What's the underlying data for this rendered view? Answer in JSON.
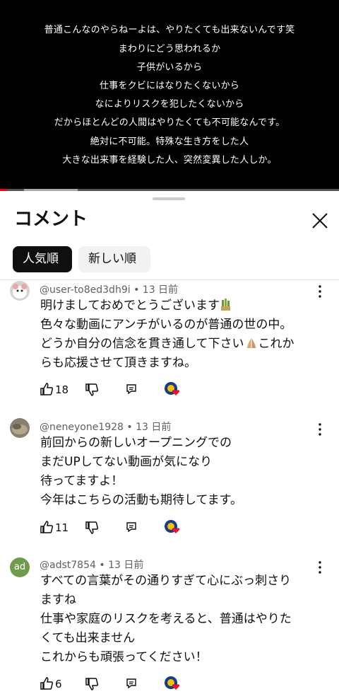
{
  "video": {
    "subtitles": [
      "普通こんなのやらねーよは、やりたくても出来ないんです笑",
      "まわりにどう思われるか",
      "子供がいるから",
      "仕事をクビにはなりたくないから",
      "なによりリスクを犯したくないから",
      "だからほとんどの人間はやりたくても不可能なんです。",
      "絶対に不可能。特殊な生き方をした人",
      "大きな出来事を経験した人、突然変異した人しか。"
    ],
    "progress_fraction": 0.02,
    "buffer_fraction": 0.23,
    "colors": {
      "progress": "#ff0000",
      "buffer": "#aaaaaa"
    }
  },
  "panel": {
    "title": "コメント",
    "close_icon": "close-icon",
    "chips": {
      "popular": "人気順",
      "newest": "新しい順"
    }
  },
  "comments": [
    {
      "author": "@user-to8ed3dh9i",
      "age": "13 日前",
      "lines": [
        "明けましておめでとうございます",
        "色々な動画にアンチがいるのが普通の世の中。",
        "どうか自分の信念を貫き通して下さい",
        "らも応援させて頂きますね。"
      ],
      "line3_tail": "これか",
      "emojis": [
        "kadomatsu-emoji",
        "praying-hands-emoji"
      ],
      "likes": "18"
    },
    {
      "author": "@neneyone1928",
      "age": "13 日前",
      "lines": [
        "前回からの新しいオープニングでの",
        "まだUPしてない動画が気になり",
        "待ってますよ！",
        "今年はこちらの活動も期待してます。"
      ],
      "likes": "11"
    },
    {
      "author": "@adst7854",
      "age": "13 日前",
      "avatar_text": "ad",
      "lines": [
        "すべての言葉がその通りすぎて心にぶっ刺さり",
        "ますね",
        "仕事や家庭のリスクを考えると、普通はやりた",
        "くても出来ません",
        "これからも頑張ってください！"
      ],
      "likes": "6"
    }
  ],
  "icons": {
    "like": "thumbs-up-icon",
    "dislike": "thumbs-down-icon",
    "reply": "reply-icon",
    "creator_heart": "creator-heart-icon",
    "more": "more-vert-icon"
  },
  "colors": {
    "avatar_ad": "#6f9b4c",
    "heart": "#e5172f"
  }
}
